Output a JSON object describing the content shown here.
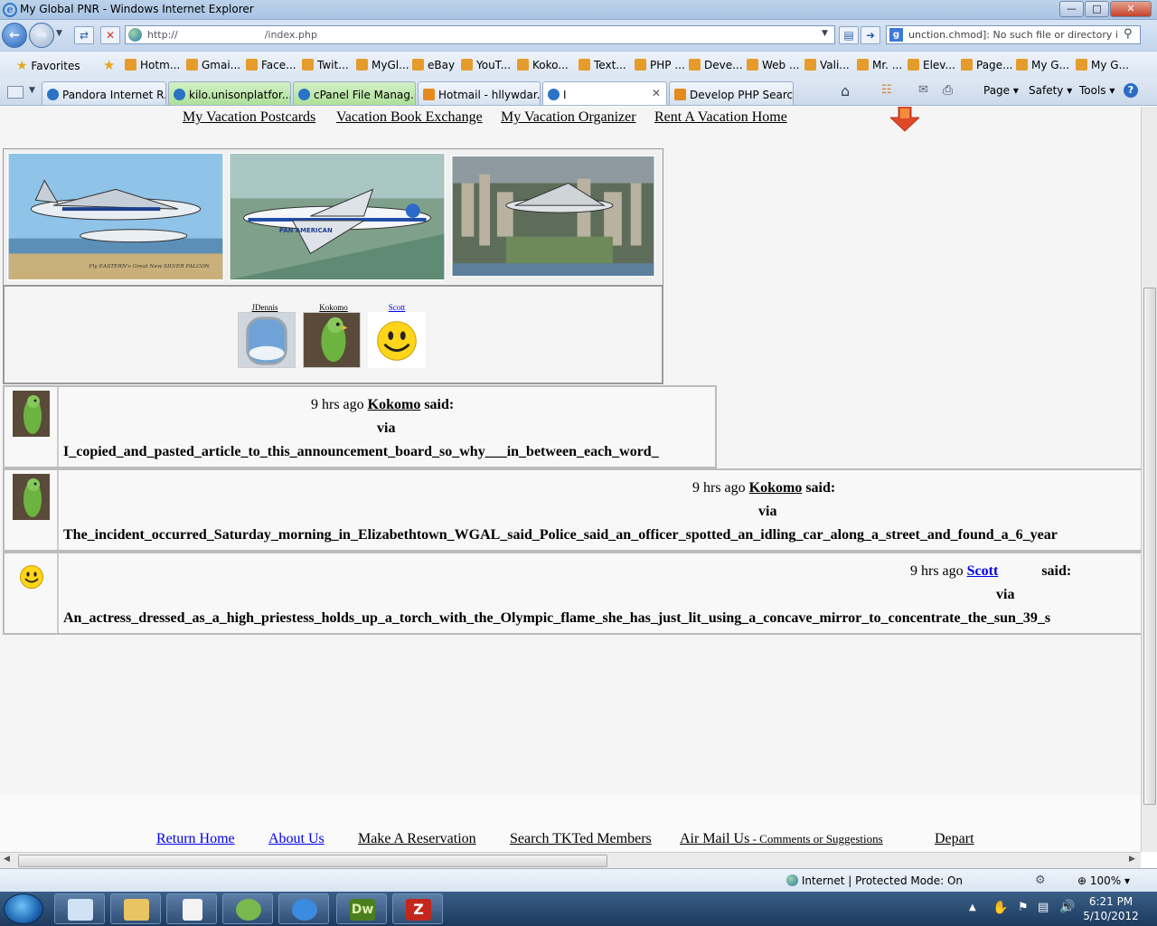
{
  "window": {
    "title": "My Global PNR - Windows Internet Explorer"
  },
  "address": {
    "url_prefix": "http://",
    "url_suffix": "/index.php"
  },
  "search": {
    "text": "unction.chmod]: No such file or directory in"
  },
  "favorites": {
    "label": "Favorites",
    "items": [
      "Hotm...",
      "Gmai...",
      "Face...",
      "Twit...",
      "MyGl...",
      "eBay",
      "YouT...",
      "Koko...",
      "Text...",
      "PHP ...",
      "Deve...",
      "Web ...",
      "Vali...",
      "Mr. ...",
      "Elev...",
      "Page...",
      "My G...",
      "My G..."
    ]
  },
  "tabs": [
    {
      "label": "Pandora Internet R..."
    },
    {
      "label": "kilo.unisonplatfor..."
    },
    {
      "label": "cPanel File Manag..."
    },
    {
      "label": "Hotmail - hllywdar..."
    },
    {
      "label": "I"
    },
    {
      "label": "Develop PHP Search"
    }
  ],
  "commands": {
    "page": "Page",
    "safety": "Safety",
    "tools": "Tools"
  },
  "page": {
    "top_links": [
      "My Vacation Postcards",
      "Vacation Book Exchange",
      "My Vacation Organizer",
      "Rent A Vacation Home"
    ],
    "members": [
      {
        "name": "JDennis"
      },
      {
        "name": "Kokomo"
      },
      {
        "name": "Scott"
      }
    ],
    "posts": [
      {
        "time": "9 hrs ago",
        "author": "Kokomo",
        "said": "said:",
        "via": "via",
        "text": "I_copied_and_pasted_article_to_this_announcement_board_so_why___in_between_each_word_"
      },
      {
        "time": "9 hrs ago",
        "author": "Kokomo",
        "said": "said:",
        "via": "via",
        "text": "The_incident_occurred_Saturday_morning_in_Elizabethtown_WGAL_said_Police_said_an_officer_spotted_an_idling_car_along_a_street_and_found_a_6_year"
      },
      {
        "time": "9 hrs ago",
        "author": "Scott",
        "said": "said:",
        "via": "via",
        "text": "An_actress_dressed_as_a_high_priestess_holds_up_a_torch_with_the_Olympic_flame_she_has_just_lit_using_a_concave_mirror_to_concentrate_the_sun_39_s"
      }
    ],
    "footer": {
      "return_home": "Return Home",
      "about_us": "About Us",
      "make_reservation": "Make A Reservation",
      "search_members": "Search TKTed Members",
      "air_mail": "Air Mail Us",
      "air_mail_small": " - Comments or Suggestions",
      "depart": "Depart"
    }
  },
  "status": {
    "zone": "Internet | Protected Mode: On",
    "zoom": "100%"
  },
  "clock": {
    "time": "6:21 PM",
    "date": "5/10/2012"
  }
}
